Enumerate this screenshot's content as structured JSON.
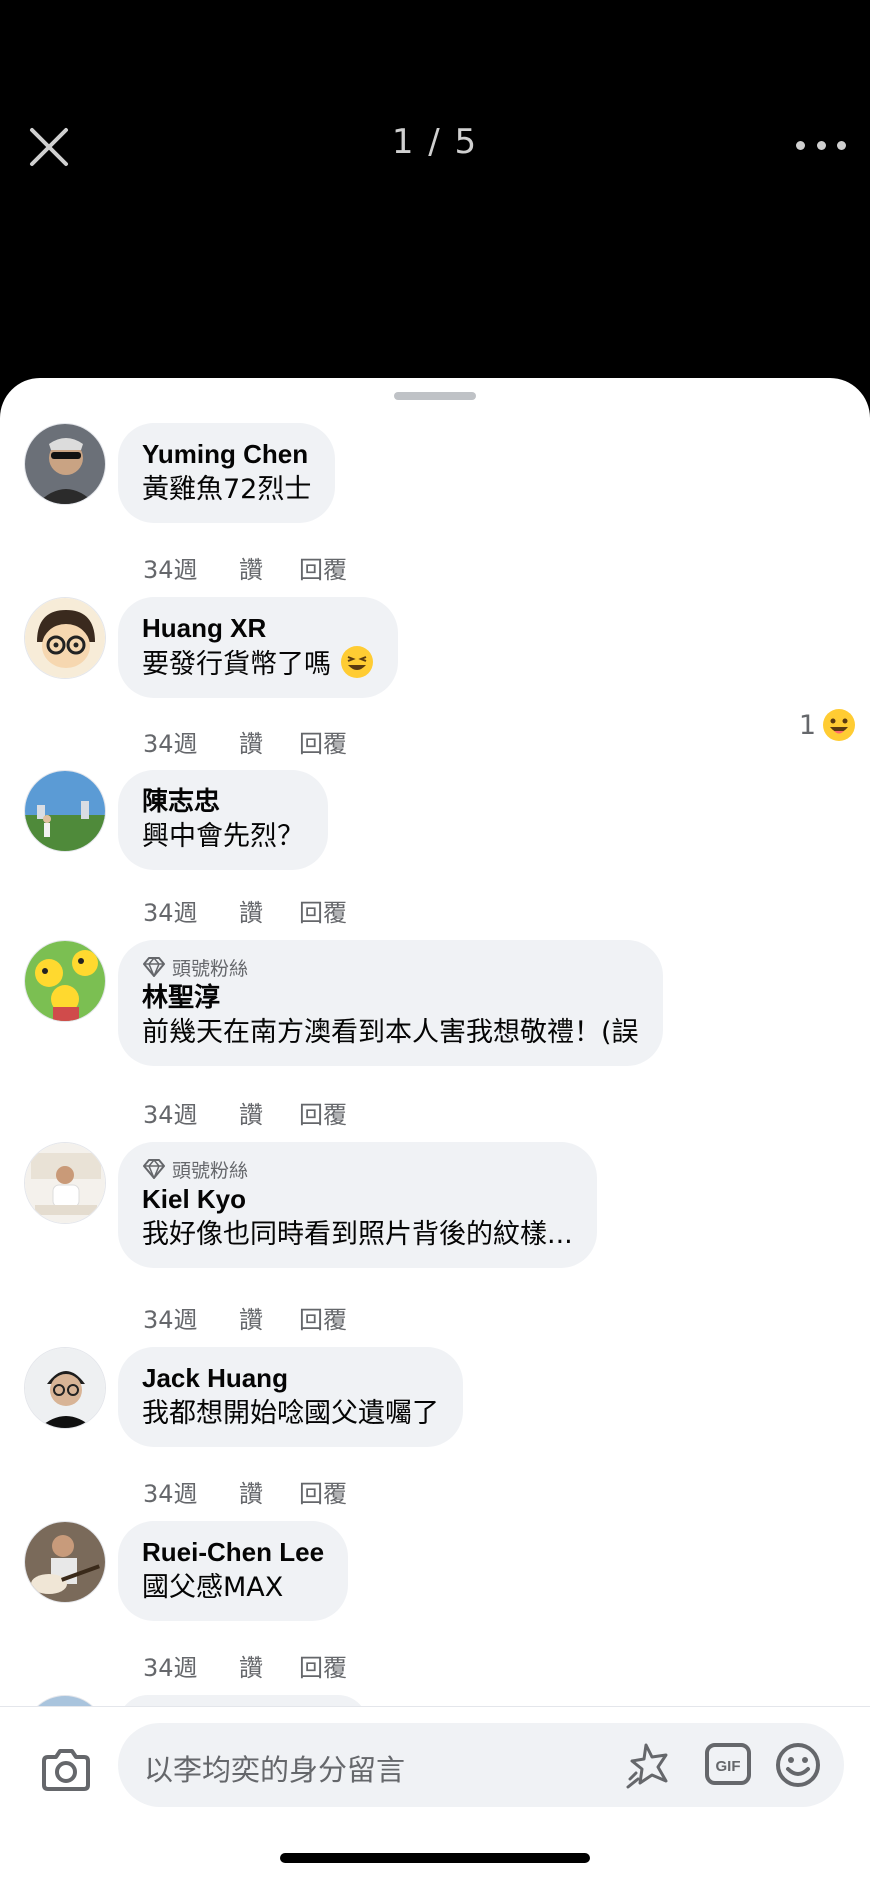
{
  "viewer": {
    "counter": "1 / 5"
  },
  "comments": [
    {
      "name": "Yuming Chen",
      "text": "黃雞魚72烈士",
      "time": "34週",
      "like": "讚",
      "reply": "回覆"
    },
    {
      "name": "Huang XR",
      "text": "要發行貨幣了嗎",
      "time": "34週",
      "like": "讚",
      "reply": "回覆",
      "reaction_count": "1"
    },
    {
      "name": "陳志忠",
      "text": "興中會先烈？",
      "time": "34週",
      "like": "讚",
      "reply": "回覆"
    },
    {
      "badge": "頭號粉絲",
      "name": "林聖淳",
      "text": "前幾天在南方澳看到本人害我想敬禮！(誤",
      "time": "34週",
      "like": "讚",
      "reply": "回覆"
    },
    {
      "badge": "頭號粉絲",
      "name": "Kiel Kyo",
      "text": "我好像也同時看到照片背後的紋樣...",
      "time": "34週",
      "like": "讚",
      "reply": "回覆"
    },
    {
      "name": "Jack Huang",
      "text": "我都想開始唸國父遺囑了",
      "time": "34週",
      "like": "讚",
      "reply": "回覆"
    },
    {
      "name": "Ruei-Chen Lee",
      "text": "國父感MAX",
      "time": "34週",
      "like": "讚",
      "reply": "回覆"
    }
  ],
  "composer": {
    "placeholder": "以李均奕的身分留言"
  },
  "icons": {
    "close": "close-icon",
    "more": "more-icon",
    "badge": "diamond-icon",
    "camera": "camera-icon",
    "sticker": "sticker-icon",
    "gif": "gif-icon",
    "emoji": "smiley-icon"
  },
  "colors": {
    "bubble": "#f0f2f5",
    "meta": "#65676b",
    "reaction": "#ffd23f"
  }
}
